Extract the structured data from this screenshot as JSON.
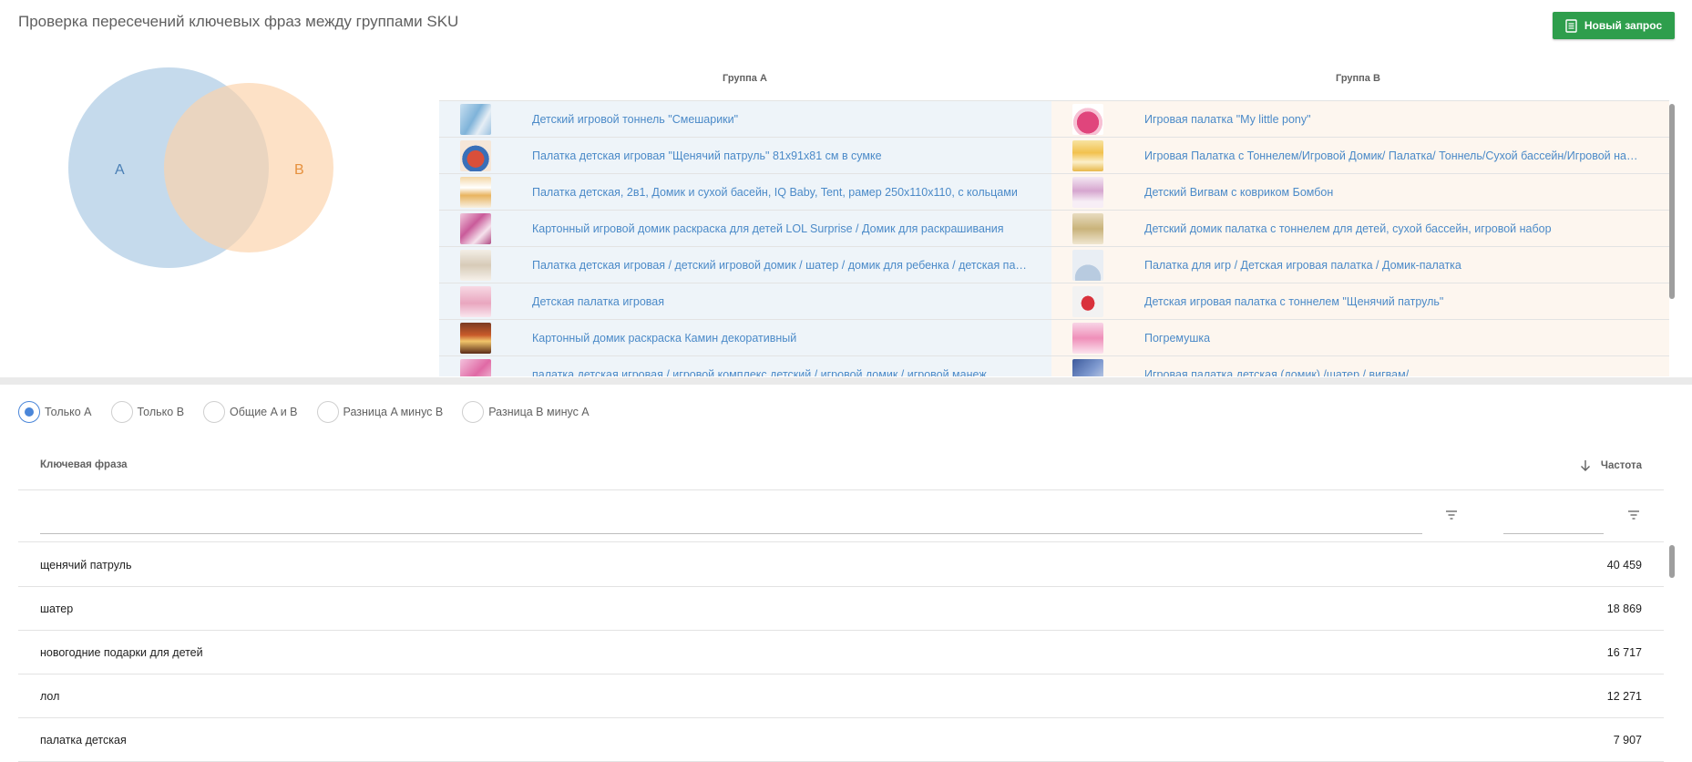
{
  "page": {
    "title": "Проверка пересечений ключевых фраз между группами SKU"
  },
  "toolbar": {
    "new_request_label": "Новый запрос"
  },
  "venn": {
    "label_a": "A",
    "label_b": "B",
    "color_a": "#a9c8e3",
    "color_b": "#fcd3ab"
  },
  "groups": {
    "header_a": "Группа A",
    "header_b": "Группа B"
  },
  "sku_rows": [
    {
      "a": "Детский игровой тоннель \"Смешарики\"",
      "b": "Игровая палатка \"My little pony\""
    },
    {
      "a": "Палатка детская игровая \"Щенячий патруль\" 81х91х81 см в сумке",
      "b": "Игровая Палатка с Тоннелем/Игровой Домик/ Палатка/ Тоннель/Сухой бассейн/Игровой набор"
    },
    {
      "a": "Палатка детская, 2в1, Домик и сухой басейн, IQ Baby, Tent, рамер 250х110х110, с кольцами",
      "b": "Детский Вигвам с ковриком Бомбон"
    },
    {
      "a": "Картонный игровой домик раскраска для детей LOL Surprise / Домик для раскрашивания",
      "b": "Детский домик палатка с тоннелем для детей, сухой бассейн, игровой набор"
    },
    {
      "a": "Палатка детская игровая / детский игровой домик / шатер / домик для ребенка / детская палатка",
      "b": "Палатка для игр / Детская игровая палатка / Домик-палатка"
    },
    {
      "a": "Детская палатка игровая",
      "b": "Детская игровая палатка с тоннелем \"Щенячий патруль\""
    },
    {
      "a": "Картонный домик раскраска Камин декоративный",
      "b": "Погремушка"
    },
    {
      "a": "палатка детская игровая / игровой комплекс детский / игровой домик / игровой манеж",
      "b": "Игровая палатка детская (домик) /шатер / вигвам/"
    }
  ],
  "filters": {
    "options": [
      "Только A",
      "Только B",
      "Общие A и B",
      "Разница A минус B",
      "Разница B минус A"
    ],
    "selected_index": 0
  },
  "keywords": {
    "col_phrase": "Ключевая фраза",
    "col_freq": "Частота",
    "sort": "desc",
    "rows": [
      {
        "phrase": "щенячий патруль",
        "freq": "40 459"
      },
      {
        "phrase": "шатер",
        "freq": "18 869"
      },
      {
        "phrase": "новогодние подарки для детей",
        "freq": "16 717"
      },
      {
        "phrase": "лол",
        "freq": "12 271"
      },
      {
        "phrase": "палатка детская",
        "freq": "7 907"
      }
    ]
  },
  "colors": {
    "accent": "#4a86d9",
    "primary_button": "#2e9e4c",
    "link": "#4b8ac8",
    "group_a_bg": "#eef4f9",
    "group_b_bg": "#fdf6ef"
  }
}
